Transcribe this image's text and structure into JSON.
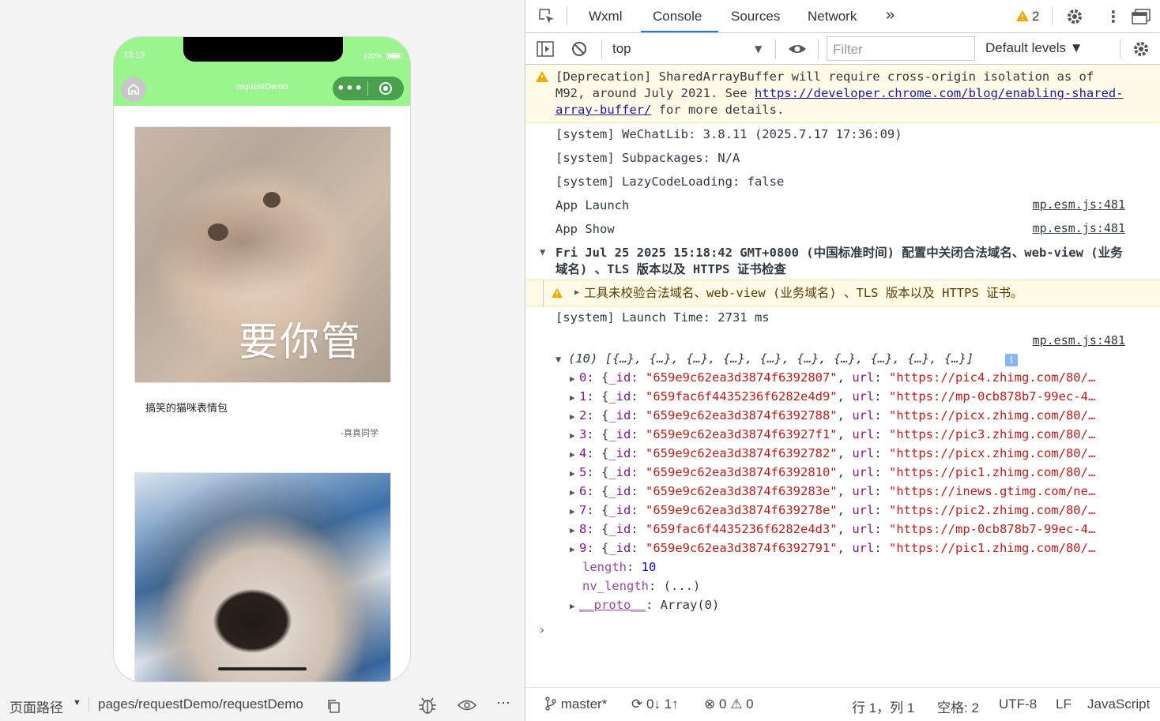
{
  "simulator": {
    "status_time": "15:19",
    "battery_text": "100%",
    "nav_title": "requestDemo",
    "capsule_dots": "•••",
    "cards": [
      {
        "caption": "要你管",
        "title": "搞笑的猫咪表情包",
        "author": "-真真同学"
      }
    ],
    "bottom": {
      "path_label": "页面路径",
      "dropdown": "▼",
      "path": "pages/requestDemo/requestDemo"
    }
  },
  "devtools": {
    "tabs": [
      "Wxml",
      "Console",
      "Sources",
      "Network"
    ],
    "active_tab": "Console",
    "more_tabs": "»",
    "warning_count": "2",
    "toolbar": {
      "context": "top",
      "filter_placeholder": "Filter",
      "levels": "Default levels ▼"
    },
    "console": {
      "deprecation_prefix": "[Deprecation] SharedArrayBuffer will require cross-origin isolation as of M92, around July 2021. See ",
      "deprecation_link": "https://developer.chrome.com/blog/enabling-shared-array-buffer/",
      "deprecation_suffix": " for more details.",
      "system_lines": [
        "[system] WeChatLib: 3.8.11 (2025.7.17 17:36:09)",
        "[system] Subpackages: N/A",
        "[system] LazyCodeLoading: false"
      ],
      "app_launch": "App Launch",
      "app_show": "App Show",
      "source_ref": "mp.esm.js:481",
      "group_header": "Fri Jul 25 2025 15:18:42 GMT+0800 (中国标准时间) 配置中关闭合法域名、web-view (业务域名) 、TLS 版本以及 HTTPS 证书检查",
      "group_warning": "工具未校验合法域名、web-view (业务域名) 、TLS 版本以及 HTTPS 证书。",
      "launch_time": "[system] Launch Time: 2731 ms",
      "array_summary": "(10) [{…}, {…}, {…}, {…}, {…}, {…}, {…}, {…}, {…}, {…}]",
      "array_items": [
        {
          "index": "0",
          "id": "\"659e9c62ea3d3874f6392807\"",
          "url": "\"https://pic4.zhimg.com/80/…"
        },
        {
          "index": "1",
          "id": "\"659fac6f4435236f6282e4d9\"",
          "url": "\"https://mp-0cb878b7-99ec-4…"
        },
        {
          "index": "2",
          "id": "\"659e9c62ea3d3874f6392788\"",
          "url": "\"https://picx.zhimg.com/80/…"
        },
        {
          "index": "3",
          "id": "\"659e9c62ea3d3874f63927f1\"",
          "url": "\"https://pic3.zhimg.com/80/…"
        },
        {
          "index": "4",
          "id": "\"659e9c62ea3d3874f6392782\"",
          "url": "\"https://picx.zhimg.com/80/…"
        },
        {
          "index": "5",
          "id": "\"659e9c62ea3d3874f6392810\"",
          "url": "\"https://pic1.zhimg.com/80/…"
        },
        {
          "index": "6",
          "id": "\"659e9c62ea3d3874f639283e\"",
          "url": "\"https://inews.gtimg.com/ne…"
        },
        {
          "index": "7",
          "id": "\"659e9c62ea3d3874f639278e\"",
          "url": "\"https://pic2.zhimg.com/80/…"
        },
        {
          "index": "8",
          "id": "\"659fac6f4435236f6282e4d3\"",
          "url": "\"https://mp-0cb878b7-99ec-4…"
        },
        {
          "index": "9",
          "id": "\"659e9c62ea3d3874f6392791\"",
          "url": "\"https://pic1.zhimg.com/80/…"
        }
      ],
      "length_key": "length",
      "length_value": "10",
      "nv_length_key": "nv_length",
      "nv_length_value": "(...)",
      "proto_key": "__proto__",
      "proto_value": "Array(0)"
    },
    "bottom": {
      "branch": "master*",
      "sync": "0↓ 1↑",
      "errors": "0",
      "warnings": "0",
      "position": "行 1，列 1",
      "spaces": "空格: 2",
      "encoding": "UTF-8",
      "eol": "LF",
      "language": "JavaScript"
    }
  },
  "colors": {
    "nav_green": "#9bf58f",
    "capsule_green": "#4aa04d",
    "accent_blue": "#1a73e8",
    "warn_bg": "#fffbe6"
  }
}
